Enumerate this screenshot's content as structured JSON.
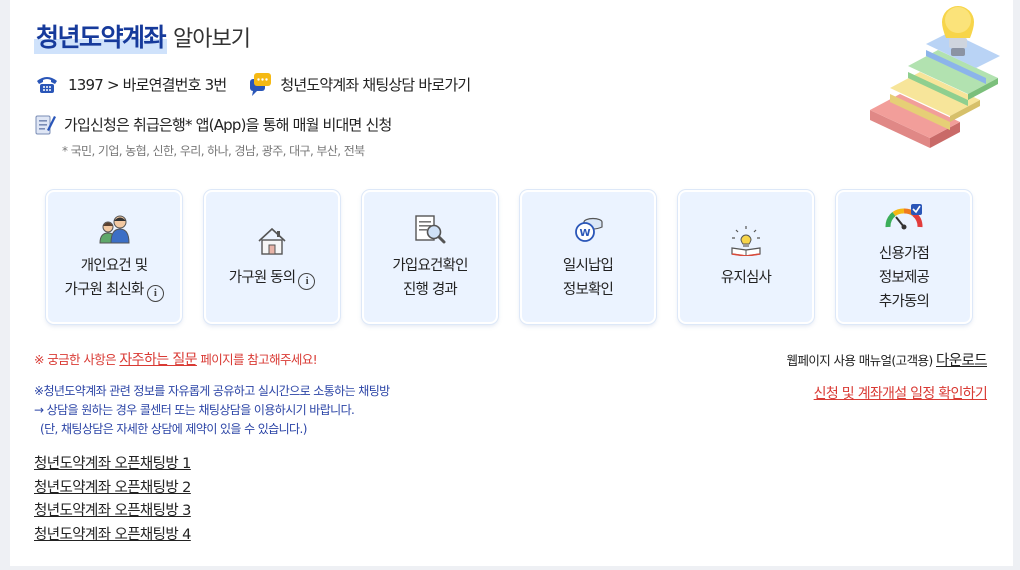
{
  "header": {
    "title_main": "청년도약계좌",
    "title_sub": "알아보기"
  },
  "contact": {
    "phone_text": "1397 > 바로연결번호 3번",
    "chat_text": "청년도약계좌 채팅상담 바로가기"
  },
  "apply": {
    "text": "가입신청은 취급은행* 앱(App)을 통해 매월 비대면 신청",
    "banks": "* 국민, 기업, 농협, 신한, 우리, 하나, 경남, 광주, 대구, 부산, 전북"
  },
  "cards": [
    {
      "line1": "개인요건 및",
      "line2": "가구원 최신화",
      "icon": "people-icon",
      "info": "i"
    },
    {
      "line1": "가구원 동의",
      "icon": "house-icon",
      "info": "i"
    },
    {
      "line1": "가입요건확인",
      "line2": "진행 경과",
      "icon": "document-search-icon"
    },
    {
      "line1": "일시납입",
      "line2": "정보확인",
      "icon": "coins-icon"
    },
    {
      "line1": "유지심사",
      "icon": "book-lightbulb-icon"
    },
    {
      "line1": "신용가점",
      "line2": "정보제공",
      "line3": "추가동의",
      "icon": "credit-gauge-icon"
    }
  ],
  "faq": {
    "prefix": "※ 궁금한 사항은",
    "link": "자주하는 질문",
    "suffix": "페이지를 참고해주세요!"
  },
  "manual": {
    "prefix": "웹페이지 사용 매뉴얼(고객용)",
    "link": "다운로드"
  },
  "schedule_link": "신청 및 계좌개설 일정 확인하기",
  "chat_notes": [
    "※청년도약계좌 관련 정보를 자유롭게 공유하고 실시간으로 소통하는 채팅방",
    "→ 상담을 원하는 경우 콜센터 또는 채팅상담을 이용하시기 바랍니다.",
    "(단, 채팅상담은 자세한 상담에 제약이 있을 수 있습니다.)"
  ],
  "open_chat_rooms": [
    "청년도약계좌 오픈채팅방 1",
    "청년도약계좌 오픈채팅방 2",
    "청년도약계좌 오픈채팅방 3",
    "청년도약계좌 오픈채팅방 4"
  ],
  "colors": {
    "title_blue": "#163a9b",
    "highlight": "#cfe2fb",
    "alert_red": "#d93a34",
    "note_blue": "#2b44a6",
    "card_bg": "#ebf3ff"
  }
}
